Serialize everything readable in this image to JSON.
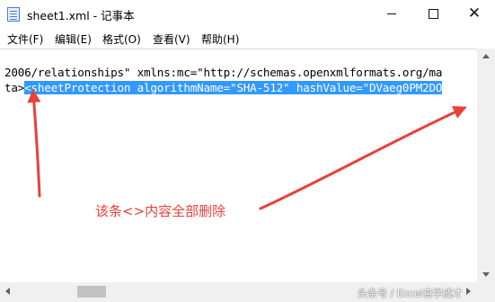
{
  "window": {
    "title": "sheet1.xml - 记事本",
    "minimize_icon": "minimize-icon",
    "maximize_icon": "maximize-icon",
    "close_icon": "close-icon",
    "close_glyph": "✕"
  },
  "menu": {
    "items": [
      "文件(F)",
      "编辑(E)",
      "格式(O)",
      "查看(V)",
      "帮助(H)"
    ]
  },
  "editor": {
    "line1": "2006/relationships\" xmlns:mc=\"http://schemas.openxmlformats.org/ma",
    "line2_prefix": "ta>",
    "line2_selected": "<sheetProtection algorithmName=\"SHA-512\" hashValue=\"DVaeg0PM2DO",
    "selection_color": "#3399ff"
  },
  "annotation": {
    "note": "该条<>内容全部删除",
    "arrow_color": "#e8413a"
  },
  "watermark": "头条号 / Excel自学成才"
}
